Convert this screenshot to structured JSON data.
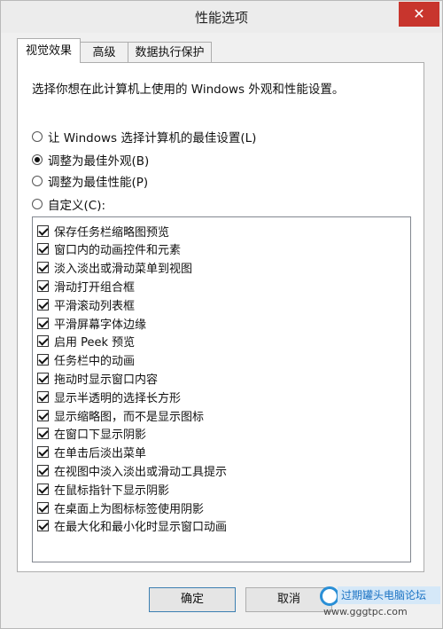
{
  "window": {
    "title": "性能选项",
    "close": "✕"
  },
  "tabs": [
    {
      "label": "视觉效果",
      "active": true
    },
    {
      "label": "高级",
      "active": false
    },
    {
      "label": "数据执行保护",
      "active": false
    }
  ],
  "panel": {
    "description": "选择你想在此计算机上使用的 Windows 外观和性能设置。",
    "radios": [
      {
        "label": "让 Windows 选择计算机的最佳设置(L)",
        "checked": false
      },
      {
        "label": "调整为最佳外观(B)",
        "checked": true
      },
      {
        "label": "调整为最佳性能(P)",
        "checked": false
      },
      {
        "label": "自定义(C):",
        "checked": false
      }
    ],
    "checkboxes": [
      {
        "label": "保存任务栏缩略图预览",
        "checked": true
      },
      {
        "label": "窗口内的动画控件和元素",
        "checked": true
      },
      {
        "label": "淡入淡出或滑动菜单到视图",
        "checked": true
      },
      {
        "label": "滑动打开组合框",
        "checked": true
      },
      {
        "label": "平滑滚动列表框",
        "checked": true
      },
      {
        "label": "平滑屏幕字体边缘",
        "checked": true
      },
      {
        "label": "启用 Peek 预览",
        "checked": true
      },
      {
        "label": "任务栏中的动画",
        "checked": true
      },
      {
        "label": "拖动时显示窗口内容",
        "checked": true
      },
      {
        "label": "显示半透明的选择长方形",
        "checked": true
      },
      {
        "label": "显示缩略图，而不是显示图标",
        "checked": true
      },
      {
        "label": "在窗口下显示阴影",
        "checked": true
      },
      {
        "label": "在单击后淡出菜单",
        "checked": true
      },
      {
        "label": "在视图中淡入淡出或滑动工具提示",
        "checked": true
      },
      {
        "label": "在鼠标指针下显示阴影",
        "checked": true
      },
      {
        "label": "在桌面上为图标标签使用阴影",
        "checked": true
      },
      {
        "label": "在最大化和最小化时显示窗口动画",
        "checked": true
      }
    ]
  },
  "buttons": {
    "ok": "确定",
    "cancel": "取消"
  },
  "watermark": {
    "title": "过期罐头电脑论坛",
    "url": "www.gggtpc.com"
  }
}
